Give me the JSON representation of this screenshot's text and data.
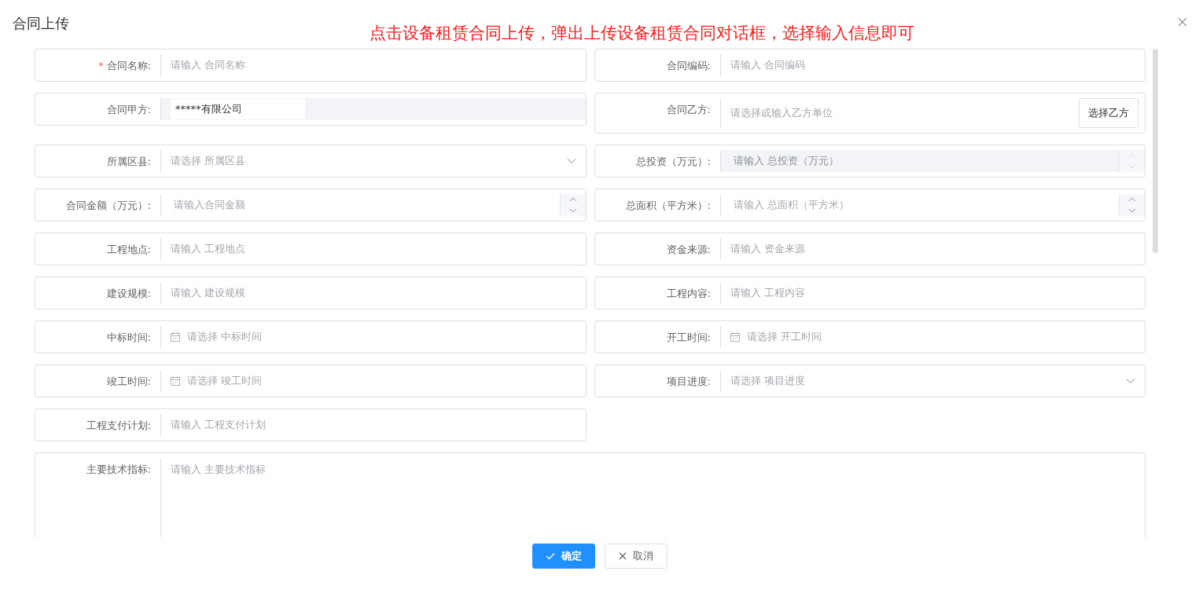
{
  "dialog": {
    "title": "合同上传",
    "annotation": "点击设备租赁合同上传，弹出上传设备租赁合同对话框，选择输入信息即可",
    "fields": [
      {
        "kind": "text",
        "required_mark": "*",
        "label": "合同名称:",
        "disabled": false,
        "placeholder": "请输入 合同名称"
      },
      {
        "kind": "text",
        "label": "合同编码:",
        "disabled": false,
        "placeholder": "请输入 合同编码"
      },
      {
        "kind": "text",
        "label": "合同甲方:",
        "disabled": true,
        "value": "*****有限公司"
      },
      {
        "kind": "picker",
        "label": "合同乙方:",
        "disabled": false,
        "placeholder": "请选择或输入乙方单位",
        "button": "选择乙方"
      },
      {
        "kind": "select",
        "label": "所属区县:",
        "disabled": false,
        "placeholder": "请选择 所属区县"
      },
      {
        "kind": "number",
        "label": "总投资（万元）:",
        "disabled": true,
        "placeholder": "请输入 总投资（万元）"
      },
      {
        "kind": "number",
        "label": "合同金额（万元）:",
        "disabled": false,
        "placeholder": "请输入合同金额"
      },
      {
        "kind": "number",
        "label": "总面积（平方米）:",
        "disabled": false,
        "placeholder": "请输入 总面积（平方米）"
      },
      {
        "kind": "text",
        "label": "工程地点:",
        "disabled": false,
        "placeholder": "请输入 工程地点"
      },
      {
        "kind": "text",
        "label": "资金来源:",
        "disabled": false,
        "placeholder": "请输入 资金来源"
      },
      {
        "kind": "text",
        "label": "建设规模:",
        "disabled": false,
        "placeholder": "请输入 建设规模"
      },
      {
        "kind": "text",
        "label": "工程内容:",
        "disabled": false,
        "placeholder": "请输入 工程内容"
      },
      {
        "kind": "date",
        "label": "中标时间:",
        "disabled": false,
        "placeholder": "请选择 中标时间"
      },
      {
        "kind": "date",
        "label": "开工时间:",
        "disabled": false,
        "placeholder": "请选择 开工时间"
      },
      {
        "kind": "date",
        "label": "竣工时间:",
        "disabled": false,
        "placeholder": "请选择 竣工时间"
      },
      {
        "kind": "select",
        "label": "项目进度:",
        "disabled": false,
        "placeholder": "请选择 项目进度"
      },
      {
        "kind": "text",
        "label": "工程支付计划:",
        "disabled": false,
        "placeholder": "请输入 工程支付计划"
      },
      {
        "kind": "textarea",
        "label": "主要技术指标:",
        "disabled": false,
        "placeholder": "请输入 主要技术指标"
      }
    ],
    "buttons": [
      {
        "kind": "primary",
        "label": "确定"
      },
      {
        "kind": "default",
        "label": "取消"
      }
    ]
  }
}
